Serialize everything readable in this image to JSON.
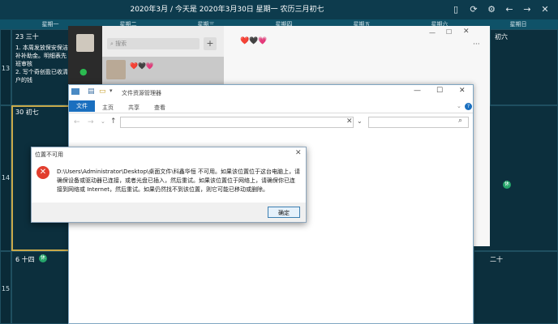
{
  "calendar": {
    "title": "2020年3月 / 今天是 2020年3月30日 星期一 农历三月初七",
    "weekdays": [
      "星期一",
      "星期二",
      "星期三",
      "星期四",
      "星期五",
      "星期六",
      "星期日"
    ],
    "weeks": [
      "13",
      "14",
      "15"
    ],
    "cells": {
      "r1c1_day": "23 三十",
      "r1c1_notes": [
        "1. 本周发放保安保洁",
        "补补助金。明细表先",
        "班审核",
        "2. 写个奇创盈已收清",
        "户的钱"
      ],
      "r2c1_day": "30 初七",
      "r3c1_day": "6 十四",
      "r3c7_day": "二十",
      "r1c7_day": "初六"
    },
    "holiday_badge": "休"
  },
  "chat": {
    "search_placeholder": "搜索",
    "add_label": "+",
    "contact_name": "❤️🖤💗",
    "conversation_title": "❤️🖤💗",
    "more_label": "···"
  },
  "explorer": {
    "title": "文件资源管理器",
    "tabs": [
      "文件",
      "主页",
      "共享",
      "查看"
    ],
    "help_label": "?"
  },
  "dialog": {
    "title": "位置不可用",
    "message": "D:\\Users\\Administrator\\Desktop\\桌面文件\\科鑫华恒 不可用。如果该位置位于这台电脑上，请确保设备或驱动器已连接，或者光盘已插入，然后重试。如果该位置位于网络上，请确保你已连接到网络或 Internet，然后重试。如果仍然找不到该位置，则它可能已移动或删除。",
    "ok_label": "确定"
  }
}
